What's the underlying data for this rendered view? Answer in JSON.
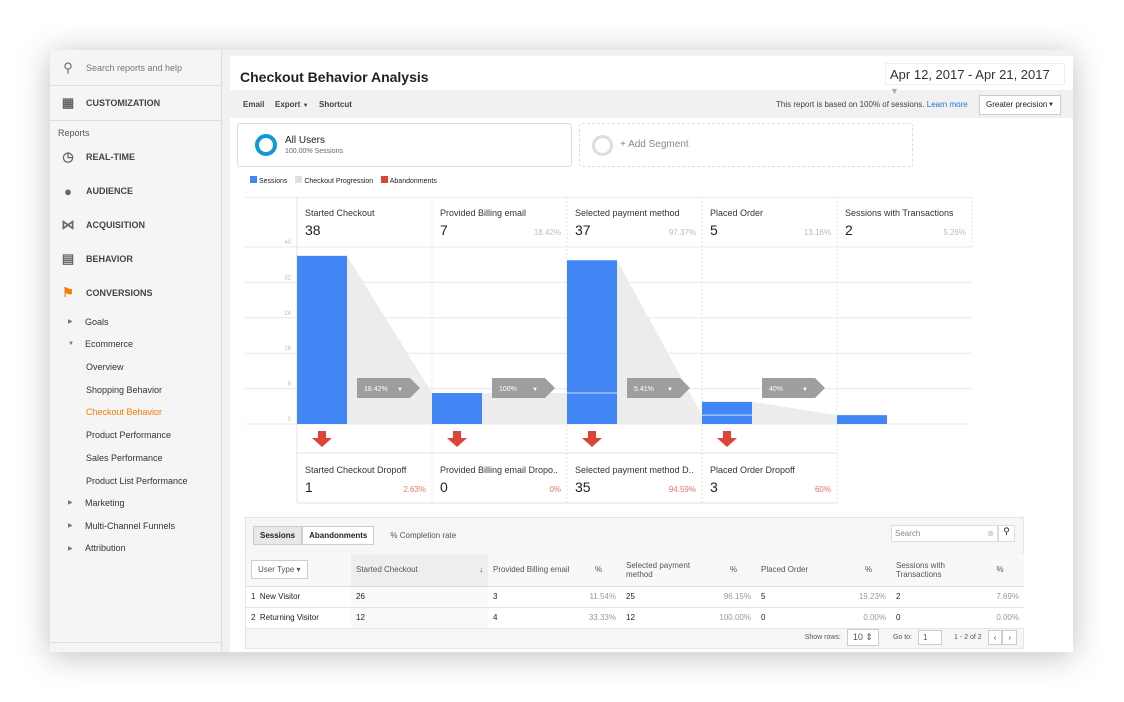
{
  "sidebar": {
    "search_placeholder": "Search reports and help",
    "customization": "CUSTOMIZATION",
    "reports_label": "Reports",
    "sections": [
      {
        "label": "REAL-TIME",
        "icon": "clock-icon"
      },
      {
        "label": "AUDIENCE",
        "icon": "person-icon"
      },
      {
        "label": "ACQUISITION",
        "icon": "acquisition-icon"
      },
      {
        "label": "BEHAVIOR",
        "icon": "behavior-icon"
      },
      {
        "label": "CONVERSIONS",
        "icon": "flag-icon"
      }
    ],
    "conversions_items": {
      "goals": "Goals",
      "ecommerce": "Ecommerce",
      "overview": "Overview",
      "shopping": "Shopping Behavior",
      "checkout": "Checkout Behavior",
      "product_perf": "Product Performance",
      "sales_perf": "Sales Performance",
      "product_list": "Product List Performance",
      "marketing": "Marketing",
      "mcf": "Multi-Channel Funnels",
      "attribution": "Attribution"
    },
    "active_color": "#f57c00"
  },
  "header": {
    "title": "Checkout Behavior Analysis",
    "date_range": "Apr 12, 2017 - Apr 21, 2017",
    "email": "Email",
    "export": "Export",
    "shortcut": "Shortcut",
    "sampling_note": "This report is based on 100% of sessions.",
    "learn_more": "Learn more",
    "precision": "Greater precision"
  },
  "segments": {
    "all_users": "All Users",
    "all_users_sub": "100.00% Sessions",
    "add_segment": "+ Add Segment"
  },
  "legend": [
    {
      "label": "Sessions",
      "color": "#4285f4"
    },
    {
      "label": "Checkout Progression",
      "color": "#e0e0e0"
    },
    {
      "label": "Abandonments",
      "color": "#db4437"
    }
  ],
  "chart_data": {
    "type": "bar",
    "categories": [
      "Started Checkout",
      "Provided Billing email",
      "Selected payment method",
      "Placed Order",
      "Sessions with Transactions"
    ],
    "values": [
      38,
      7,
      37,
      5,
      2
    ],
    "percents": [
      "",
      "18.42%",
      "97.37%",
      "13.16%",
      "5.26%"
    ],
    "carried_over": [
      null,
      7,
      7,
      2,
      2
    ],
    "progression_labels": [
      "18.42%",
      "100%",
      "5.41%",
      "40%"
    ],
    "dropoffs": [
      {
        "label": "Started Checkout Dropoff",
        "value": 1,
        "pct": "2.63%"
      },
      {
        "label": "Provided Billing email Dropo..",
        "value": 0,
        "pct": "0%"
      },
      {
        "label": "Selected payment method D..",
        "value": 35,
        "pct": "94.59%"
      },
      {
        "label": "Placed Order Dropoff",
        "value": 3,
        "pct": "60%"
      }
    ],
    "yticks": [
      0,
      8,
      16,
      24,
      32,
      40
    ],
    "ylim": [
      0,
      40
    ]
  },
  "table": {
    "tabs": [
      "Sessions",
      "Abandonments"
    ],
    "completion": "% Completion rate",
    "search_placeholder": "Search",
    "dimension": "User Type",
    "columns": [
      "Started Checkout",
      "Provided Billing email",
      "%",
      "Selected payment method",
      "%",
      "Placed Order",
      "%",
      "Sessions with Transactions",
      "%"
    ],
    "rows": [
      [
        "1",
        "New Visitor",
        "26",
        "3",
        "11.54%",
        "25",
        "96.15%",
        "5",
        "19.23%",
        "2",
        "7.69%"
      ],
      [
        "2",
        "Returning Visitor",
        "12",
        "4",
        "33.33%",
        "12",
        "100.00%",
        "0",
        "0.00%",
        "0",
        "0.00%"
      ]
    ],
    "show_rows_label": "Show rows:",
    "show_rows": "10",
    "goto_label": "Go to:",
    "goto": "1",
    "range": "1 - 2 of 2"
  }
}
